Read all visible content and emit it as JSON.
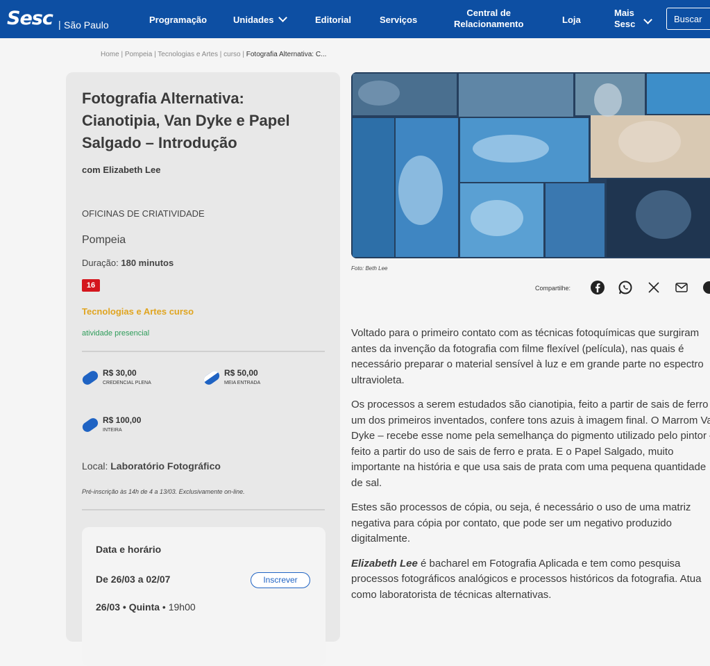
{
  "nav": {
    "logo": "Sesc",
    "separator": "|",
    "region": "São Paulo",
    "items": [
      "Programação",
      "Unidades",
      "Editorial",
      "Serviços",
      "Central de",
      "Relacionamento",
      "Loja",
      "Mais",
      "Sesc"
    ],
    "search": "Buscar"
  },
  "breadcrumb": {
    "path": "Home | Pompeia | Tecnologias e Artes | curso | ",
    "current": "Fotografia Alternativa: C..."
  },
  "event": {
    "title": "Fotografia Alternativa: Cianotipia, Van Dyke e Papel Salgado – Introdução",
    "author": "com Elizabeth Lee",
    "category": "OFICINAS DE CRIATIVIDADE",
    "unit": "Pompeia",
    "duration_label": "Duração: ",
    "duration_value": "180 minutos",
    "age_rating": "16",
    "tags": "Tecnologias e Artes  curso",
    "modality": "atividade presencial",
    "prices": [
      {
        "value": "R$ 30,00",
        "label": "CREDENCIAL PLENA"
      },
      {
        "value": "R$ 50,00",
        "label": "MEIA ENTRADA"
      },
      {
        "value": "R$ 100,00",
        "label": "INTEIRA"
      }
    ],
    "local_label": "Local: ",
    "local_value": "Laboratório Fotográfico",
    "prereg": "Pré-inscrição às 14h de 4 a 13/03. Exclusivamente on-line.",
    "schedule": {
      "title": "Data e horário",
      "range": "De 26/03 a 02/07",
      "button": "Inscrever",
      "session_date": "26/03 • Quinta",
      "session_time": " • 19h00"
    }
  },
  "photo": {
    "caption": "Foto: Beth Lee"
  },
  "share": {
    "label": "Compartilhe:",
    "icons": [
      "facebook-icon",
      "whatsapp-icon",
      "x-icon",
      "mail-icon"
    ]
  },
  "article": {
    "p1": "Voltado para o primeiro contato com as técnicas fotoquímicas que surgiram antes da invenção da fotografia com filme flexível (película), nas quais é necessário preparar o material sensível à luz e em grande parte no espectro ultravioleta.",
    "p2": "Os processos a serem estudados são cianotipia, feito a partir de sais de ferro – um dos primeiros inventados, confere tons azuis à imagem final. O Marrom Van Dyke – recebe esse nome pela semelhança do pigmento utilizado pelo pintor – feito a partir do uso de sais de ferro e prata. E o Papel Salgado, muito importante na história e que usa sais de prata com uma pequena quantidade de sal.",
    "p3": "Estes são processos de cópia, ou seja, é necessário o uso de uma matriz negativa para cópia por contato, que pode ser um negativo produzido digitalmente.",
    "p4_lead": "Elizabeth Lee",
    "p4": " é bacharel em Fotografia Aplicada e tem como pesquisa processos fotográficos analógicos e processos históricos da fotografia. Atua como laboratorista de técnicas alternativas."
  },
  "colors": {
    "nav_bg": "#0d4fa3",
    "accent_blue": "#1f63c3",
    "age_red": "#d4161d",
    "tag_yellow": "#e0a521",
    "modality_green": "#2e9c5a"
  }
}
